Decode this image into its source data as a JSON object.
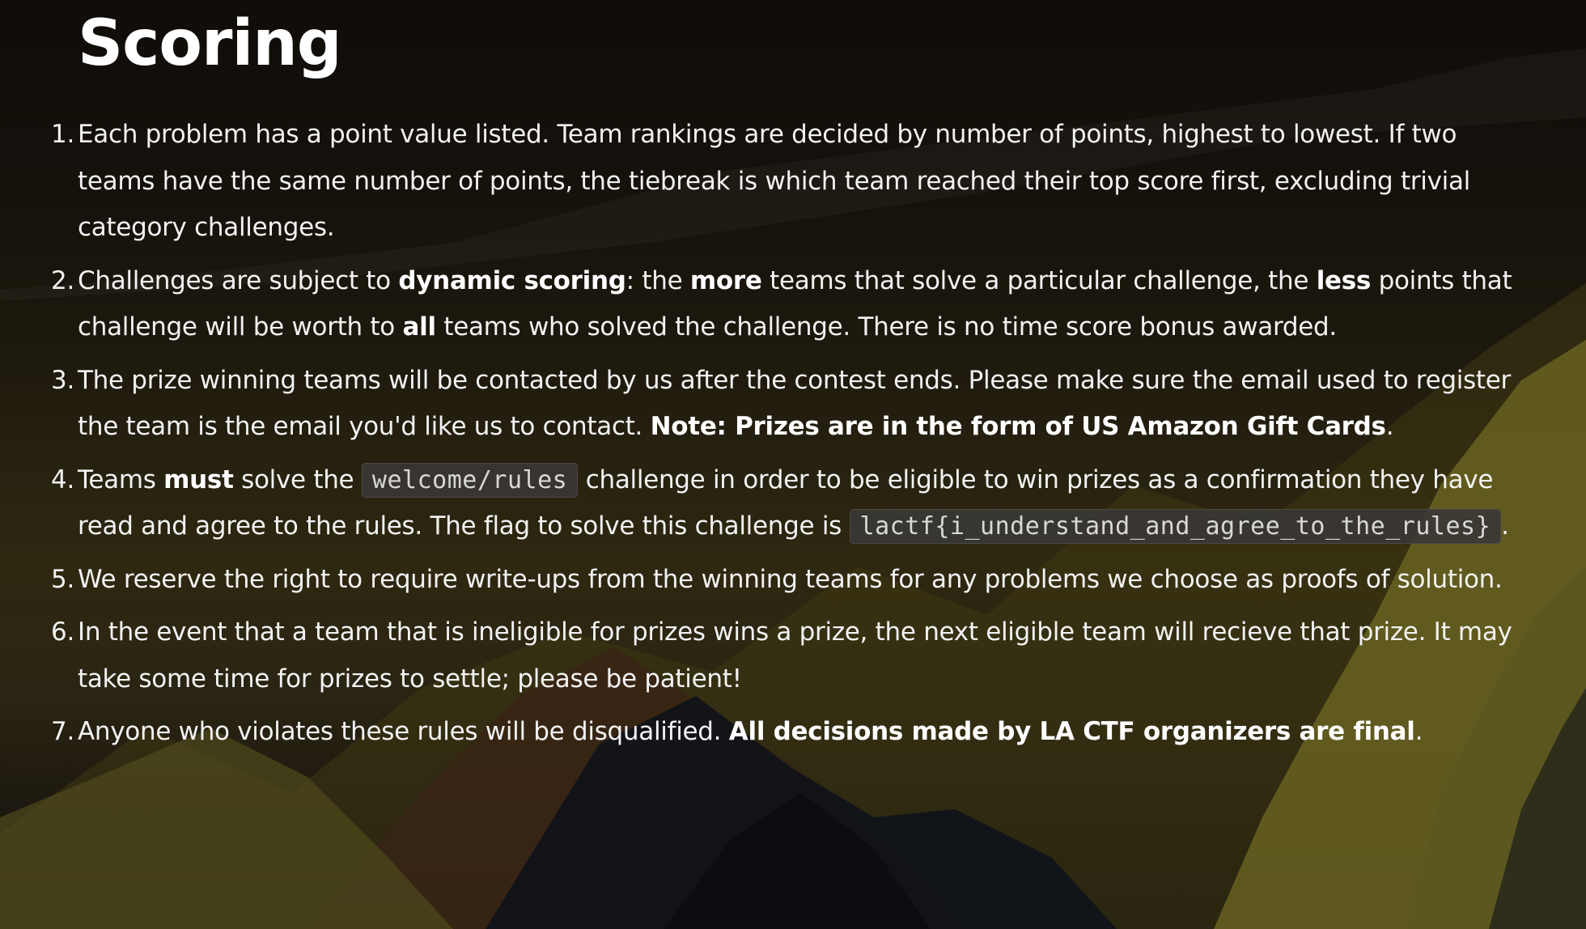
{
  "page": {
    "title": "Scoring"
  },
  "colors": {
    "background_dark": "#100d0a",
    "background_olive": "#2e2811",
    "mountain_olive": "#6b6522",
    "mountain_dark": "#0f1219",
    "code_background": "#3a3734",
    "text": "#ffffff"
  },
  "rules": [
    {
      "number": "1.",
      "text": "Each problem has a point value listed. Team rankings are decided by number of points, highest to lowest. If two teams have the same number of points, the tiebreak is which team reached their top score first, excluding trivial category challenges."
    },
    {
      "number": "2.",
      "t1": "Challenges are subject to ",
      "b1": "dynamic scoring",
      "t2": ": the ",
      "b2": "more",
      "t3": " teams that solve a particular challenge, the ",
      "b3": "less",
      "t4": " points that challenge will be worth to ",
      "b4": "all",
      "t5": " teams who solved the challenge. There is no time score bonus awarded."
    },
    {
      "number": "3.",
      "t1": "The prize winning teams will be contacted by us after the contest ends. Please make sure the email used to register the team is the email you'd like us to contact. ",
      "b1": "Note: Prizes are in the form of US Amazon Gift Cards",
      "t2": "."
    },
    {
      "number": "4.",
      "t1": "Teams ",
      "b1": "must",
      "t2": " solve the ",
      "code1": "welcome/rules",
      "t3": " challenge in order to be eligible to win prizes as a confirmation they have read and agree to the rules. The flag to solve this challenge is ",
      "code2": "lactf{i_understand_and_agree_to_the_rules}",
      "t4": "."
    },
    {
      "number": "5.",
      "text": "We reserve the right to require write-ups from the winning teams for any problems we choose as proofs of solution."
    },
    {
      "number": "6.",
      "text": "In the event that a team that is ineligible for prizes wins a prize, the next eligible team will recieve that prize. It may take some time for prizes to settle; please be patient!"
    },
    {
      "number": "7.",
      "t1": "Anyone who violates these rules will be disqualified. ",
      "b1": "All decisions made by LA CTF organizers are final",
      "t2": "."
    }
  ]
}
